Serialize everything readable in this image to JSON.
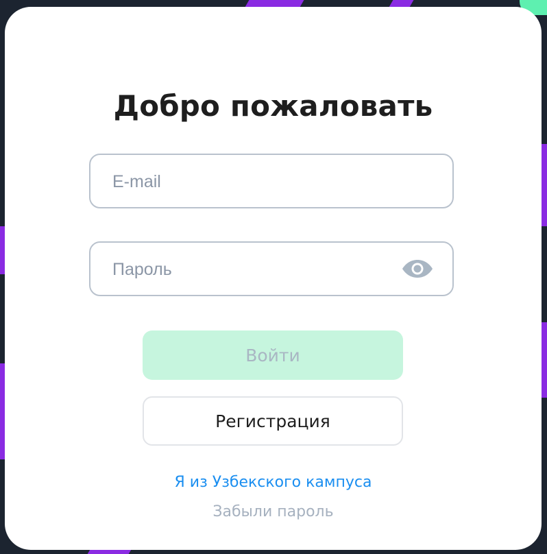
{
  "login": {
    "title": "Добро пожаловать",
    "email": {
      "placeholder": "E-mail",
      "value": ""
    },
    "password": {
      "placeholder": "Пароль",
      "value": ""
    },
    "login_label": "Войти",
    "register_label": "Регистрация",
    "campus_link": "Я из Узбекского кампуса",
    "forgot_link": "Забыли пароль"
  },
  "icons": {
    "password_toggle": "eye-icon"
  },
  "colors": {
    "background": "#1c2430",
    "accent_purple": "#8a2be2",
    "accent_green": "#5ef0b0",
    "login_button": "#c6f5de",
    "link": "#1a8ef0"
  }
}
